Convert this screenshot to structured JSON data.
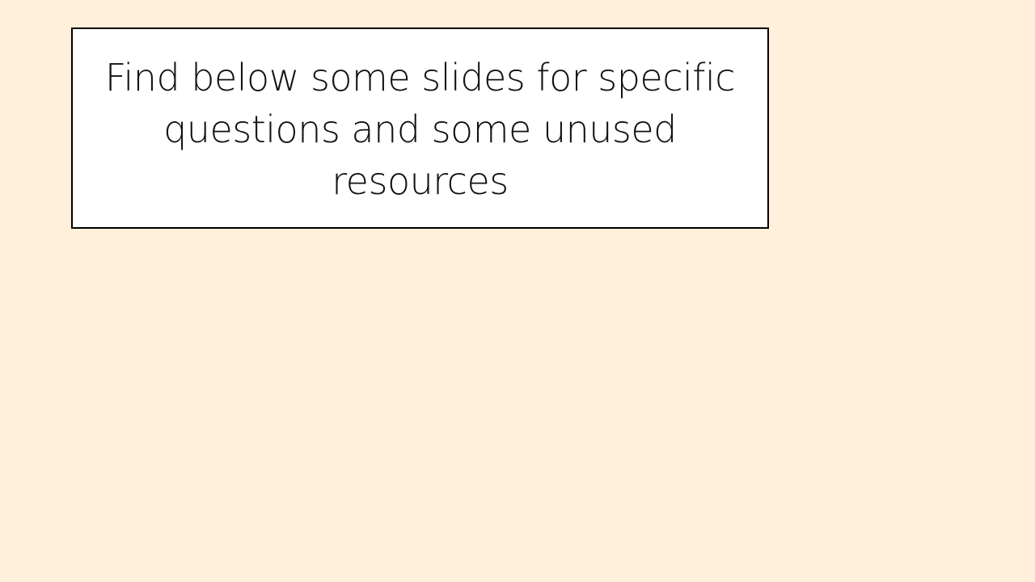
{
  "slide": {
    "background_color": "#FFEFDB",
    "text_box": {
      "lines": [
        "Find below some slides for specific",
        "questions and some unused",
        "resources"
      ],
      "border_color": "#000000",
      "fill_color": "#FFFFFF"
    }
  }
}
